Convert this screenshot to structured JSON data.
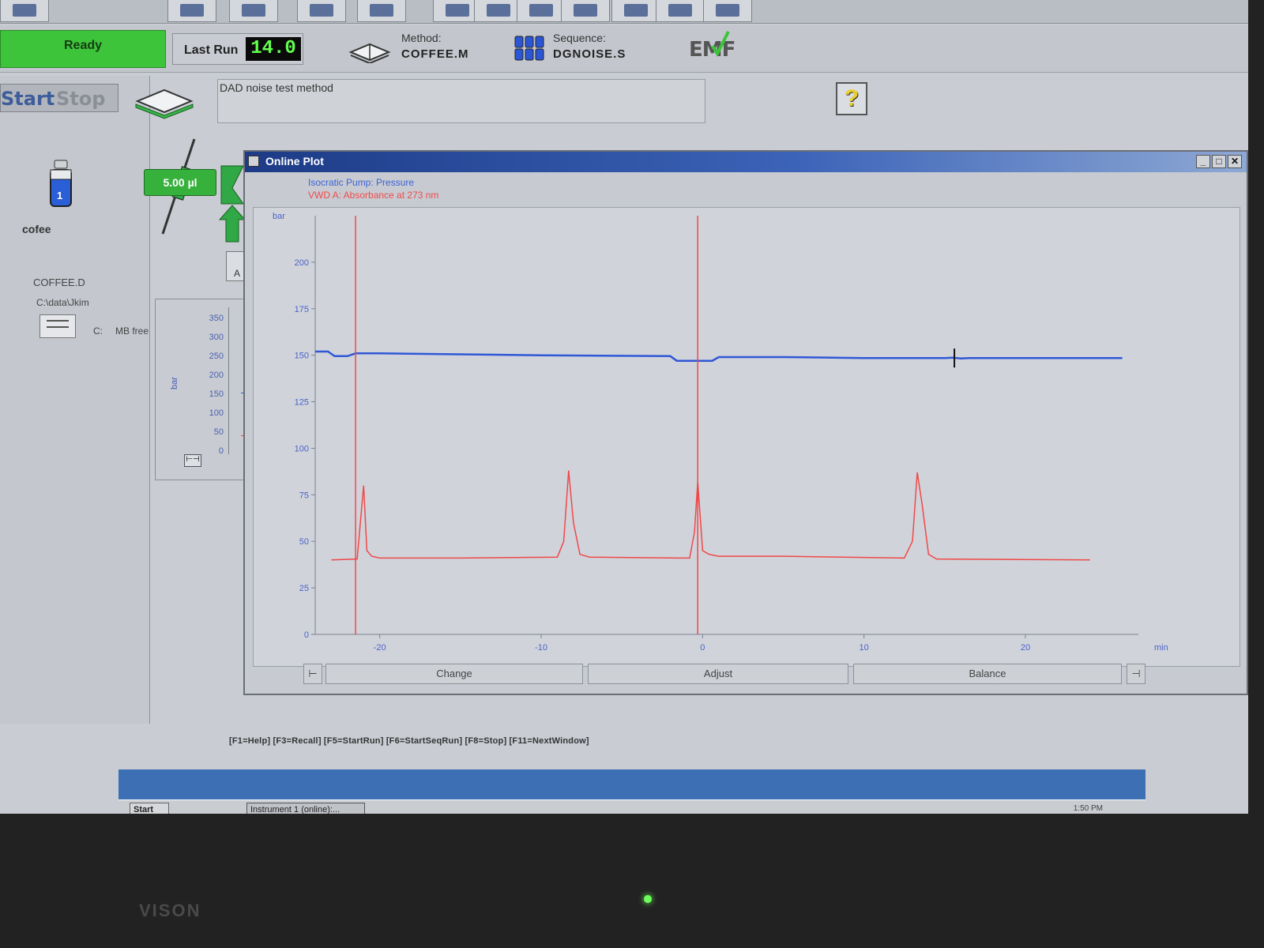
{
  "status": {
    "text": "Ready",
    "color": "#3ec43a"
  },
  "last_run": {
    "label": "Last Run",
    "value": "14.0"
  },
  "method": {
    "label": "Method:",
    "value": "COFFEE.M"
  },
  "sequence": {
    "label": "Sequence:",
    "value": "DGNOISE.S"
  },
  "emf_label": "EMF",
  "controls": {
    "start": "Start",
    "stop": "Stop"
  },
  "sample": {
    "vial_number": "1",
    "vial_name": "cofee",
    "file": "COFFEE.D",
    "path": "C:\\data\\Jkim",
    "drive": "C:",
    "free_space": "MB free"
  },
  "method_description": "DAD noise test method",
  "injection_volume": "5.00 µl",
  "injector_position": "A",
  "help_label": "?",
  "mini_plot": {
    "unit": "bar",
    "ticks": [
      "350",
      "300",
      "250",
      "200",
      "150",
      "100",
      "50",
      "0"
    ]
  },
  "online_plot": {
    "title": "Online Plot",
    "legend": [
      "Isocratic Pump: Pressure",
      "VWD A: Absorbance at 273 nm"
    ],
    "buttons": {
      "change": "Change",
      "adjust": "Adjust",
      "balance": "Balance"
    }
  },
  "chart_data": {
    "type": "line",
    "xlabel": "min",
    "ylabel": "bar",
    "xlim": [
      -24,
      27
    ],
    "ylim": [
      0,
      225
    ],
    "x_ticks": [
      "-20",
      "-10",
      "0",
      "10",
      "20"
    ],
    "y_ticks": [
      "200",
      "175",
      "150",
      "125",
      "100",
      "75",
      "50",
      "25",
      "0"
    ],
    "grid": false,
    "series": [
      {
        "name": "Isocratic Pump: Pressure",
        "color": "#2f57d6",
        "x": [
          -24,
          -23.2,
          -22.8,
          -22,
          -21.5,
          -20,
          -10,
          -2,
          -1.6,
          0.6,
          1,
          5,
          10,
          15,
          15.5,
          16,
          16.5,
          20,
          26
        ],
        "y": [
          152,
          152,
          149.5,
          149.5,
          151,
          151,
          150,
          149.5,
          147,
          147,
          149,
          149,
          148.5,
          148.5,
          148.7,
          148.3,
          148.5,
          148.5,
          148.5
        ]
      },
      {
        "name": "VWD A: Absorbance at 273 nm",
        "color": "#f04848",
        "x": [
          -23,
          -21.4,
          -21,
          -20.8,
          -20.5,
          -20,
          -15,
          -9,
          -8.6,
          -8.3,
          -8,
          -7.6,
          -7,
          -1.5,
          -0.8,
          -0.5,
          -0.3,
          0,
          0.4,
          1,
          5,
          12.5,
          13,
          13.3,
          13.6,
          14,
          14.5,
          24
        ],
        "y": [
          40,
          40.5,
          80,
          45,
          42,
          41,
          41,
          41.5,
          50,
          88,
          60,
          43,
          41.5,
          41,
          41,
          55,
          82,
          45,
          43,
          42,
          42,
          41,
          50,
          87,
          70,
          43,
          40.5,
          40
        ]
      },
      {
        "name": "run marker",
        "color": "#f04848",
        "x": [
          -21.5,
          -21.5
        ],
        "y": [
          0,
          225
        ]
      },
      {
        "name": "run marker",
        "color": "#f04848",
        "x": [
          -0.3,
          -0.3
        ],
        "y": [
          0,
          225
        ]
      }
    ]
  },
  "function_keys": "[F1=Help]  [F3=Recall]  [F5=StartRun]  [F6=StartSeqRun]  [F8=Stop]  [F11=NextWindow]",
  "taskbar": {
    "start": "Start",
    "task": "Instrument 1 (online):...",
    "clock": "1:50 PM"
  },
  "monitor_brand": "VISON"
}
